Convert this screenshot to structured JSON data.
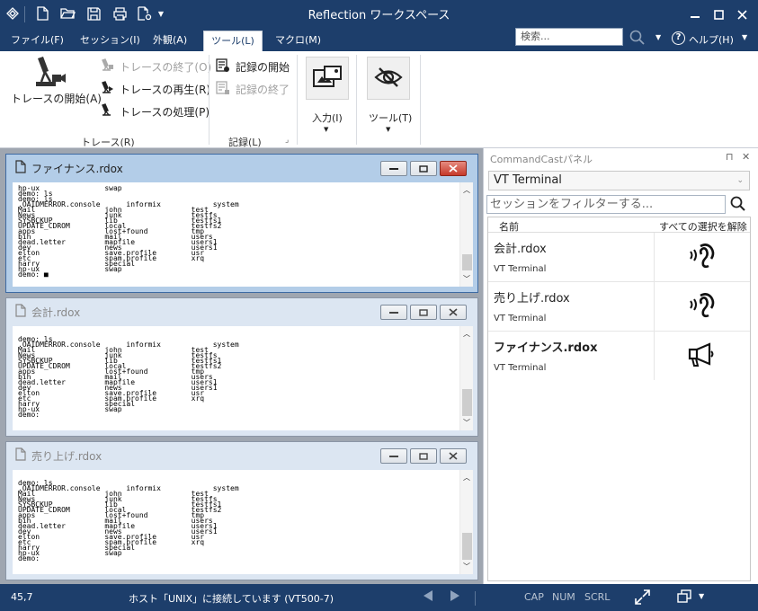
{
  "window": {
    "title": "Reflection ワークスペース"
  },
  "menu": {
    "tabs": [
      "ファイル(F)",
      "セッション(I)",
      "外観(A)",
      "ツール(L)",
      "マクロ(M)"
    ],
    "search_placeholder": "検索...",
    "help": "ヘルプ(H)"
  },
  "ribbon": {
    "trace": {
      "start": "トレースの開始(A)",
      "end": "トレースの終了(O)",
      "replay": "トレースの再生(R)",
      "process": "トレースの処理(P)",
      "group": "トレース(R)"
    },
    "record": {
      "start": "記録の開始",
      "end": "記録の終了",
      "group": "記録(L)"
    },
    "input": "入力(I)",
    "tools": "ツール(T)"
  },
  "sessions_windows": [
    {
      "title": "ファイナンス.rdox",
      "active": true,
      "text": "hp-ux               swap\ndemo: ls\ndemo: ls\n.OAIDMERROR.console      informix            system\nMail                john                test\nNews                junk                testfs\nSYSBCKUP            lib                 testfs1\nUPDATE_CDROM        local               testfs2\napps                lost+found          tmp\nbin                 mail                users\ndead.letter         mapfile             users1\ndev                 news                users1\nelton               save.profile        usr\netc                 spam.profile        xrq\nharry               special\nhp-ux               swap\ndemo: ■"
    },
    {
      "title": "会計.rdox",
      "active": false,
      "text": "demo: ls\n.OAIDMERROR.console      informix            system\nMail                john                test\nNews                junk                testfs\nSYSBCKUP            lib                 testfs1\nUPDATE_CDROM        local               testfs2\napps                lost+found          tmp\nbin                 mail                users\ndead.letter         mapfile             users1\ndev                 news                users1\nelton               save.profile        usr\netc                 spam.profile        xrq\nharry               special\nhp-ux               swap\ndemo:"
    },
    {
      "title": "売り上げ.rdox",
      "active": false,
      "text": "demo: ls\n.OAIDMERROR.console      informix            system\nMail                john                test\nNews                junk                testfs\nSYSBCKUP            lib                 testfs1\nUPDATE_CDROM        local               testfs2\napps                lost+found          tmp\nbin                 mail                users\ndead.letter         mapfile             users1\ndev                 news                users1\nelton               save.profile        usr\netc                 spam.profile        xrq\nharry               special\nhp-ux               swap\ndemo:"
    }
  ],
  "panel": {
    "title": "CommandCastパネル",
    "type": "VT Terminal",
    "filter_placeholder": "セッションをフィルターする...",
    "col_name": "名前",
    "col_action": "すべての選択を解除",
    "sessions": [
      {
        "name": "会計.rdox",
        "type": "VT Terminal",
        "icon": "ear-icon"
      },
      {
        "name": "売り上げ.rdox",
        "type": "VT Terminal",
        "icon": "ear-icon"
      },
      {
        "name": "ファイナンス.rdox",
        "type": "VT Terminal",
        "icon": "megaphone-icon"
      }
    ]
  },
  "status": {
    "pos": "45,7",
    "msg": "ホスト「UNIX」に接続しています (VT500-7)",
    "cap": "CAP",
    "num": "NUM",
    "scrl": "SCRL"
  }
}
